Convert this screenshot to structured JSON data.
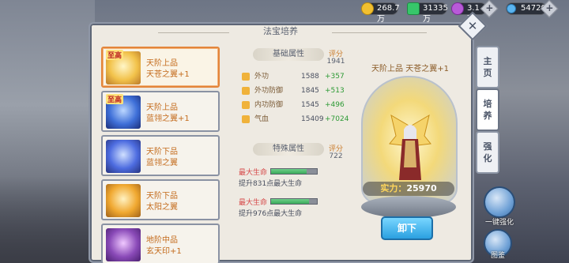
{
  "currency": [
    {
      "icon": "gold-coin-icon",
      "value": "268.7万",
      "color": "#f2c030"
    },
    {
      "icon": "green-gem-icon",
      "value": "31335万",
      "color": "#37c66a"
    },
    {
      "icon": "purple-orb-icon",
      "value": "3.1万",
      "color": "#b85ad8"
    },
    {
      "icon": "diamond-icon",
      "value": "54720",
      "color": "#5ab4f0"
    }
  ],
  "panel": {
    "title": "法宝培养"
  },
  "items": [
    {
      "tag": "至高",
      "name1": "天阶上品",
      "name2": "天苍之翼+1",
      "selected": true
    },
    {
      "tag": "至高",
      "name1": "天阶上品",
      "name2": "蓝翎之翼+1",
      "selected": false
    },
    {
      "tag": "",
      "name1": "天阶下品",
      "name2": "蓝翎之翼",
      "selected": false
    },
    {
      "tag": "",
      "name1": "天阶下品",
      "name2": "太阳之翼",
      "selected": false
    },
    {
      "tag": "",
      "name1": "地阶中品",
      "name2": "玄天印+1",
      "selected": false
    }
  ],
  "base_attr": {
    "title": "基础属性",
    "score_label": "评分",
    "score": "1941",
    "stats": [
      {
        "icon": "attack-icon",
        "name": "外功",
        "value": "1588",
        "add": "+357"
      },
      {
        "icon": "defense-icon",
        "name": "外功防御",
        "value": "1845",
        "add": "+513"
      },
      {
        "icon": "inner-defense-icon",
        "name": "内功防御",
        "value": "1545",
        "add": "+496"
      },
      {
        "icon": "health-icon",
        "name": "气血",
        "value": "15409",
        "add": "+7024"
      }
    ]
  },
  "special_attr": {
    "title": "特殊属性",
    "score_label": "评分",
    "score": "722",
    "entries": [
      {
        "title": "最大生命",
        "fill": 0.78,
        "desc": "提升831点最大生命"
      },
      {
        "title": "最大生命",
        "fill": 0.82,
        "desc": "提升976点最大生命"
      }
    ]
  },
  "showcase": {
    "item_title": "天阶上品 天苍之翼+1",
    "power_label": "实力：",
    "power": "25970",
    "unequip": "卸下"
  },
  "tabs": [
    {
      "label1": "主",
      "label2": "页",
      "active": false
    },
    {
      "label1": "培",
      "label2": "养",
      "active": true
    },
    {
      "label1": "强",
      "label2": "化",
      "active": false
    }
  ],
  "side_buttons": {
    "strengthen": "一键强化",
    "illustrated": "图鉴"
  }
}
